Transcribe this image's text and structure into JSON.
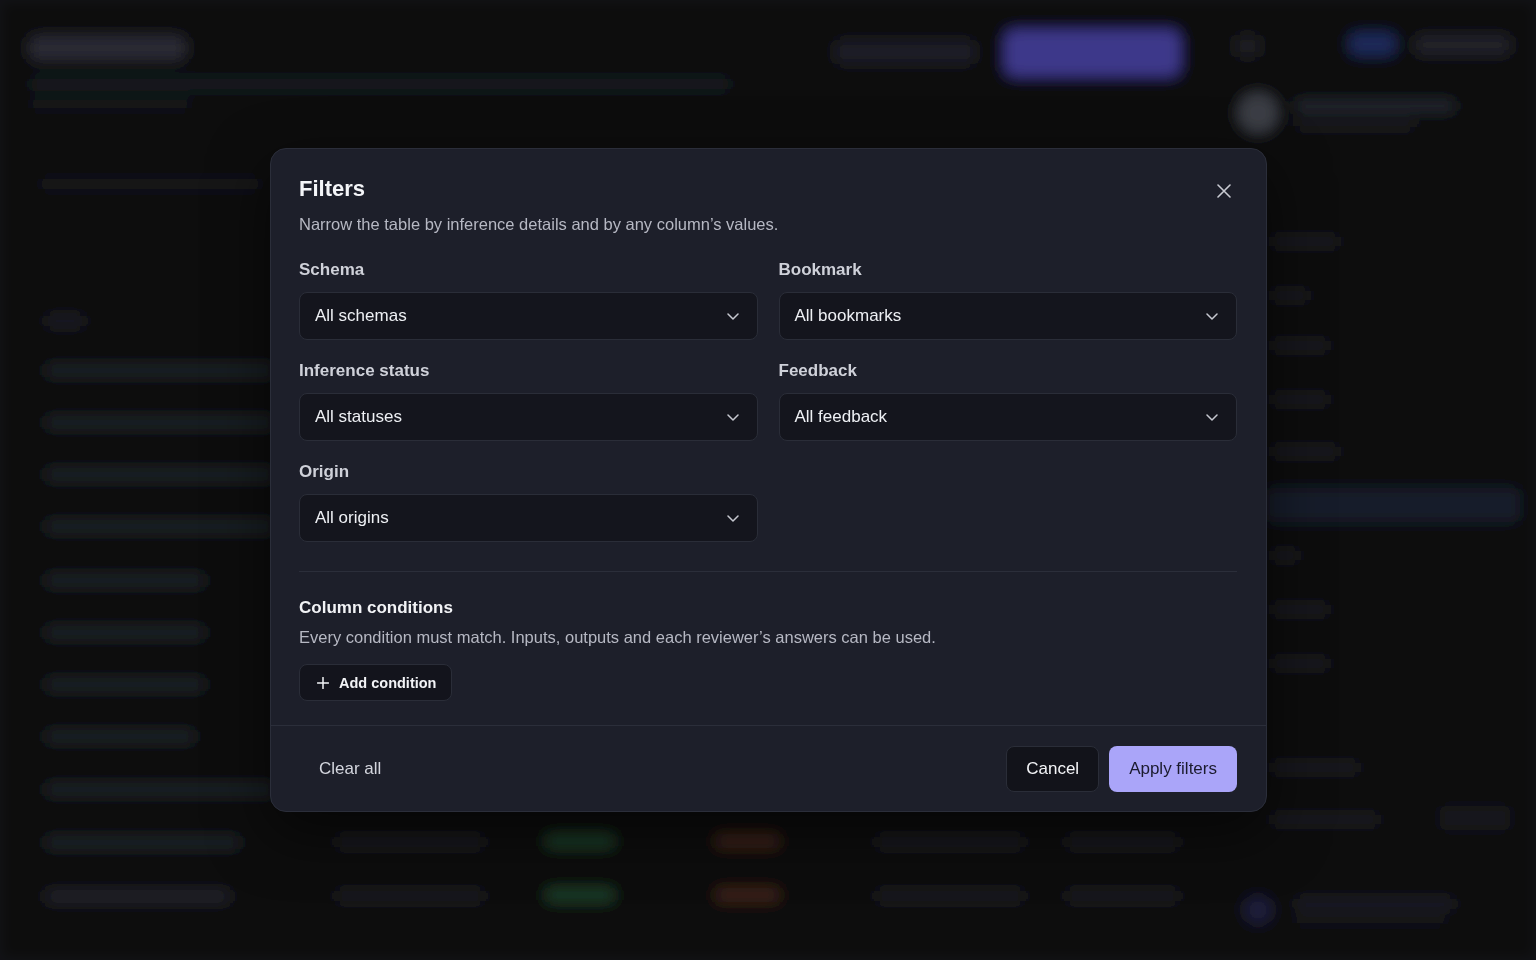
{
  "dialog": {
    "title": "Filters",
    "subtitle": "Narrow the table by inference details and by any column’s values.",
    "fields": [
      {
        "label": "Schema",
        "value": "All schemas"
      },
      {
        "label": "Bookmark",
        "value": "All bookmarks"
      },
      {
        "label": "Inference status",
        "value": "All statuses"
      },
      {
        "label": "Feedback",
        "value": "All feedback"
      },
      {
        "label": "Origin",
        "value": "All origins"
      }
    ],
    "column_conditions": {
      "title": "Column conditions",
      "description": "Every condition must match. Inputs, outputs and each reviewer’s answers can be used.",
      "add_button": "Add condition"
    },
    "footer": {
      "clear_button": "Clear all",
      "cancel_button": "Cancel",
      "apply_button": "Apply filters"
    }
  }
}
